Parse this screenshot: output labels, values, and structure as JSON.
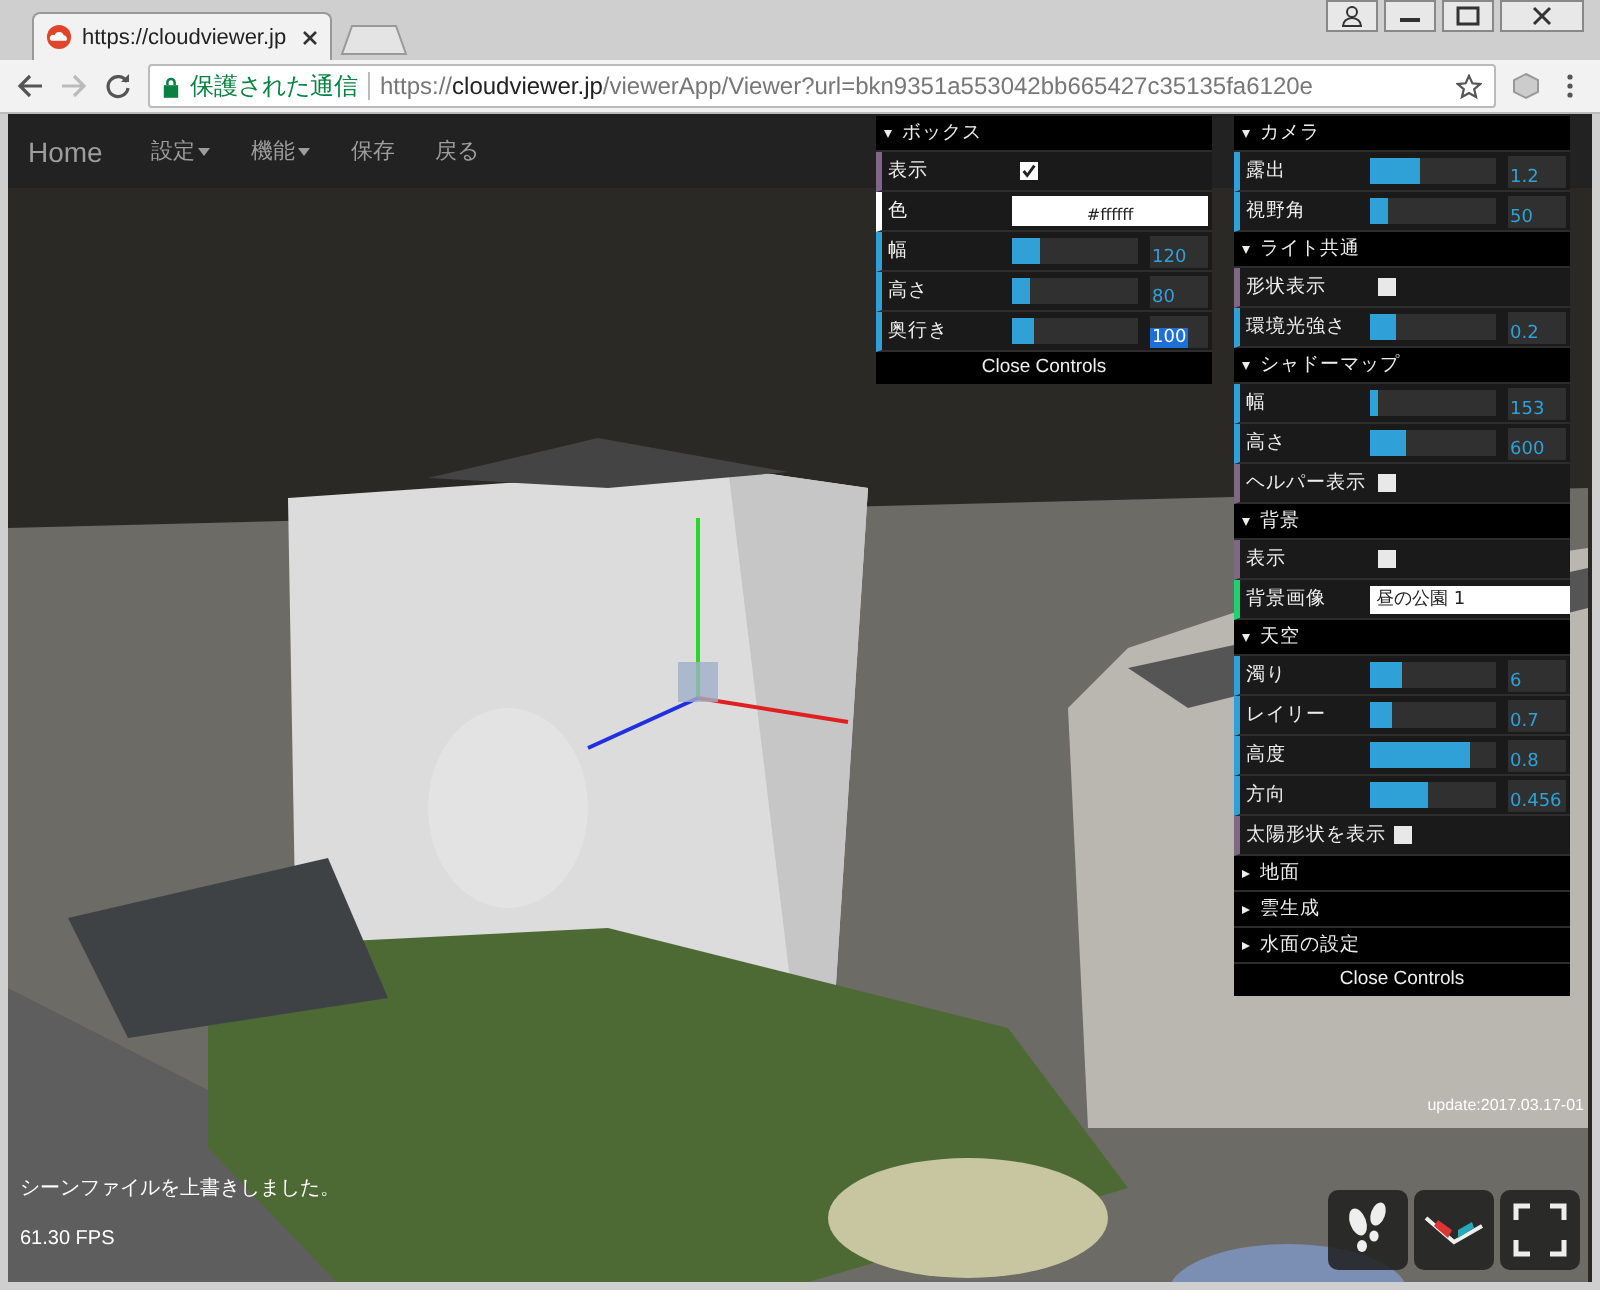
{
  "browser": {
    "tab_title": "https://cloudviewer.jp",
    "security_label": "保護された通信",
    "url_scheme": "https://",
    "url_host": "cloudviewer.jp",
    "url_path": "/viewerApp/Viewer?url=bkn9351a553042bb665427c35135fa6120e"
  },
  "nav": [
    {
      "label": "Home",
      "dropdown": false,
      "kind": "brand"
    },
    {
      "label": "設定",
      "dropdown": true,
      "kind": "item"
    },
    {
      "label": "機能",
      "dropdown": true,
      "kind": "item"
    },
    {
      "label": "保存",
      "dropdown": false,
      "kind": "item"
    },
    {
      "label": "戻る",
      "dropdown": false,
      "kind": "item"
    }
  ],
  "panels": [
    {
      "close_label": "Close Controls",
      "sections": [
        {
          "title": "ボックス",
          "expanded": true,
          "rows": [
            {
              "kind": "checkbox",
              "label": "表示",
              "checked": true
            },
            {
              "kind": "color",
              "label": "色",
              "value": "#ffffff"
            },
            {
              "kind": "slider",
              "label": "幅",
              "level": 0.22,
              "value": "120",
              "focused": false
            },
            {
              "kind": "slider",
              "label": "高さ",
              "level": 0.14,
              "value": "80",
              "focused": false
            },
            {
              "kind": "slider",
              "label": "奥行き",
              "level": 0.18,
              "value": "100",
              "focused": true
            }
          ]
        }
      ]
    },
    {
      "close_label": "Close Controls",
      "sections": [
        {
          "title": "カメラ",
          "expanded": true,
          "rows": [
            {
              "kind": "slider",
              "label": "露出",
              "level": 0.4,
              "value": "1.2",
              "focused": false
            },
            {
              "kind": "slider",
              "label": "視野角",
              "level": 0.14,
              "value": "50",
              "focused": false
            }
          ]
        },
        {
          "title": "ライト共通",
          "expanded": true,
          "rows": [
            {
              "kind": "checkbox",
              "label": "形状表示",
              "checked": false
            },
            {
              "kind": "slider",
              "label": "環境光強さ",
              "level": 0.2,
              "value": "0.2",
              "focused": false
            }
          ]
        },
        {
          "title": "シャドーマップ",
          "expanded": true,
          "rows": [
            {
              "kind": "slider",
              "label": "幅",
              "level": 0.07,
              "value": "153",
              "focused": false
            },
            {
              "kind": "slider",
              "label": "高さ",
              "level": 0.28,
              "value": "600",
              "focused": false
            },
            {
              "kind": "checkbox",
              "label": "ヘルパー表示",
              "checked": false
            }
          ]
        },
        {
          "title": "背景",
          "expanded": true,
          "rows": [
            {
              "kind": "checkbox",
              "label": "表示",
              "checked": false
            },
            {
              "kind": "text",
              "label": "背景画像",
              "value": "昼の公園 1"
            }
          ]
        },
        {
          "title": "天空",
          "expanded": true,
          "rows": [
            {
              "kind": "slider",
              "label": "濁り",
              "level": 0.25,
              "value": "6",
              "focused": false
            },
            {
              "kind": "slider",
              "label": "レイリー",
              "level": 0.17,
              "value": "0.7",
              "focused": false
            },
            {
              "kind": "slider",
              "label": "高度",
              "level": 0.8,
              "value": "0.8",
              "focused": false
            },
            {
              "kind": "slider",
              "label": "方向",
              "level": 0.46,
              "value": "0.456",
              "focused": false
            },
            {
              "kind": "checkbox",
              "label": "太陽形状を表示",
              "checked": false
            }
          ]
        },
        {
          "title": "地面",
          "expanded": false
        },
        {
          "title": "雲生成",
          "expanded": false
        },
        {
          "title": "水面の設定",
          "expanded": false
        }
      ]
    }
  ],
  "status_message": "シーンファイルを上書きしました。",
  "fps": "61.30 FPS",
  "update_label": "update:2017.03.17-01"
}
